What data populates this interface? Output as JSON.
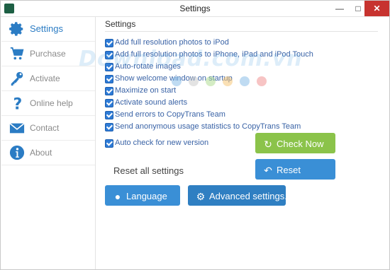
{
  "window": {
    "title": "Settings",
    "minimize_symbol": "—",
    "maximize_symbol": "□",
    "close_symbol": "✕"
  },
  "sidebar": {
    "items": [
      {
        "label": "Settings",
        "icon": "gear-icon",
        "active": true
      },
      {
        "label": "Purchase",
        "icon": "cart-icon",
        "active": false
      },
      {
        "label": "Activate",
        "icon": "key-icon",
        "active": false
      },
      {
        "label": "Online help",
        "icon": "question-icon",
        "active": false
      },
      {
        "label": "Contact",
        "icon": "envelope-icon",
        "active": false
      },
      {
        "label": "About",
        "icon": "info-icon",
        "active": false
      }
    ]
  },
  "settings": {
    "section_title": "Settings",
    "checkboxes": [
      {
        "label": "Add full resolution photos to iPod",
        "checked": true
      },
      {
        "label": "Add full resolution photos to iPhone, iPad and iPod Touch",
        "checked": true
      },
      {
        "label": "Auto-rotate images",
        "checked": true
      },
      {
        "label": "Show welcome window on startup",
        "checked": true
      },
      {
        "label": "Maximize on start",
        "checked": true
      },
      {
        "label": "Activate sound alerts",
        "checked": true
      },
      {
        "label": "Send errors to CopyTrans Team",
        "checked": true
      },
      {
        "label": "Send anonymous usage statistics to CopyTrans Team",
        "checked": true
      },
      {
        "label": "Auto check for new version",
        "checked": true
      }
    ],
    "check_now_label": "Check Now",
    "reset_all_label": "Reset all settings",
    "reset_label": "Reset",
    "language_label": "Language",
    "advanced_label": "Advanced settings..."
  },
  "watermark": {
    "text": "Download.com.vn"
  },
  "colors": {
    "accent_blue": "#3a8fd6",
    "accent_green": "#8bc34a",
    "active_nav": "#2b7cc4",
    "close_red": "#c7332f"
  }
}
